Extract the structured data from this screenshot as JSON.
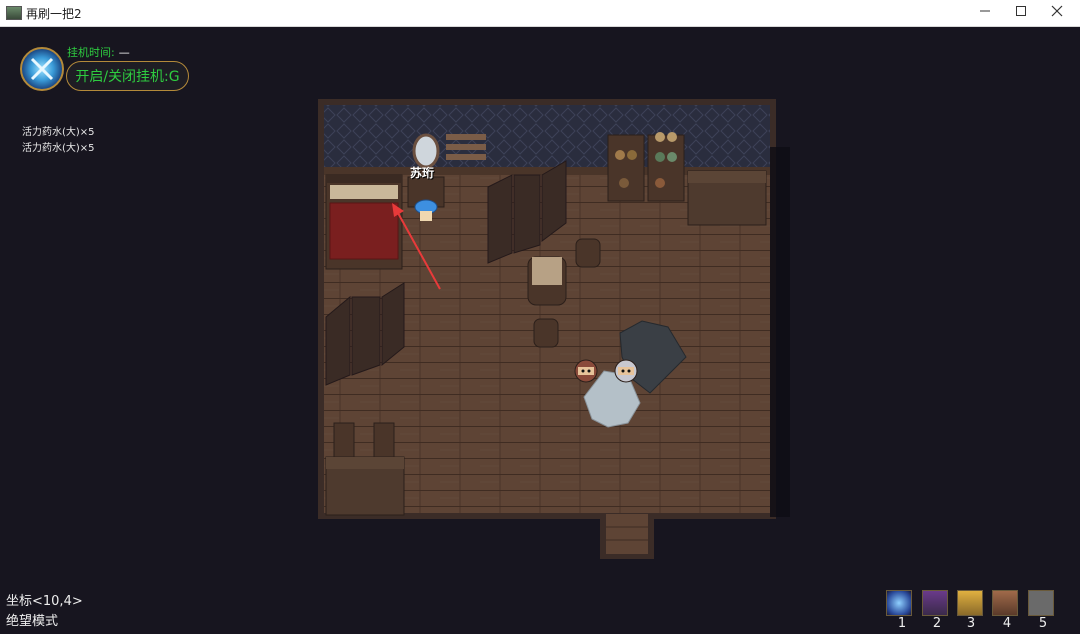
{
  "window": {
    "title": "再刷一把2"
  },
  "afk": {
    "time_label": "挂机时间:",
    "time_value": "—",
    "toggle_label": "开启/关闭挂机:G"
  },
  "loot_log": [
    "活力药水(大)×5",
    "活力药水(大)×5"
  ],
  "npc": {
    "name": "苏珩"
  },
  "status": {
    "coordinates": "坐标<10,4>",
    "mode": "绝望模式"
  },
  "hotbar": {
    "slots": [
      {
        "number": "1",
        "icon": "blue-orb-icon"
      },
      {
        "number": "2",
        "icon": "hooded-character-icon"
      },
      {
        "number": "3",
        "icon": "gold-armor-character-icon"
      },
      {
        "number": "4",
        "icon": "brown-character-icon"
      },
      {
        "number": "5",
        "icon": "empty-slot"
      }
    ]
  },
  "colors": {
    "afk_green": "#2ecc40",
    "frame_gold": "#b48a3a",
    "background": "#17151f",
    "floor": "#5e4435",
    "wall": "#2a2d3e"
  }
}
